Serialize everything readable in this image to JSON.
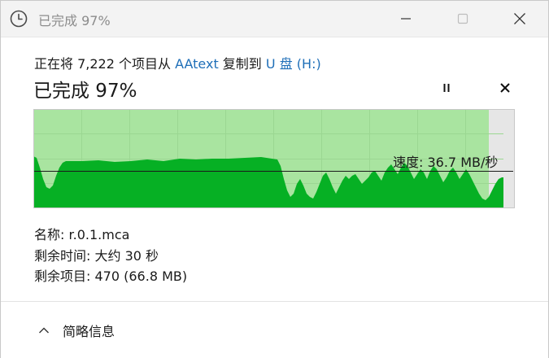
{
  "window": {
    "title": "已完成 97%"
  },
  "icons": {
    "title_icon": "clock-icon",
    "minimize": "minimize-icon",
    "maximize": "maximize-icon",
    "close": "close-icon",
    "pause": "pause-icon",
    "cancel": "cancel-icon",
    "collapse": "chevron-up-icon"
  },
  "copy": {
    "prefix": "正在将 7,222 个项目从 ",
    "source": "AAtext",
    "middle": " 复制到 ",
    "destination": "U 盘 (H:)"
  },
  "progress": {
    "title": "已完成 97%",
    "percent": 97,
    "speed_label": "速度: 36.7 MB/秒"
  },
  "details": {
    "name_label": "名称:",
    "name_value": "r.0.1.mca",
    "time_label": "剩余时间:",
    "time_value": "大约 30 秒",
    "items_label": "剩余项目:",
    "items_value": "470 (66.8 MB)"
  },
  "footer": {
    "toggle_label": "简略信息"
  },
  "colors": {
    "graph_background": "#a9e4a0",
    "graph_fill": "#06b024",
    "graph_remaining": "#e6e6e6",
    "link": "#1f6fb8"
  }
}
